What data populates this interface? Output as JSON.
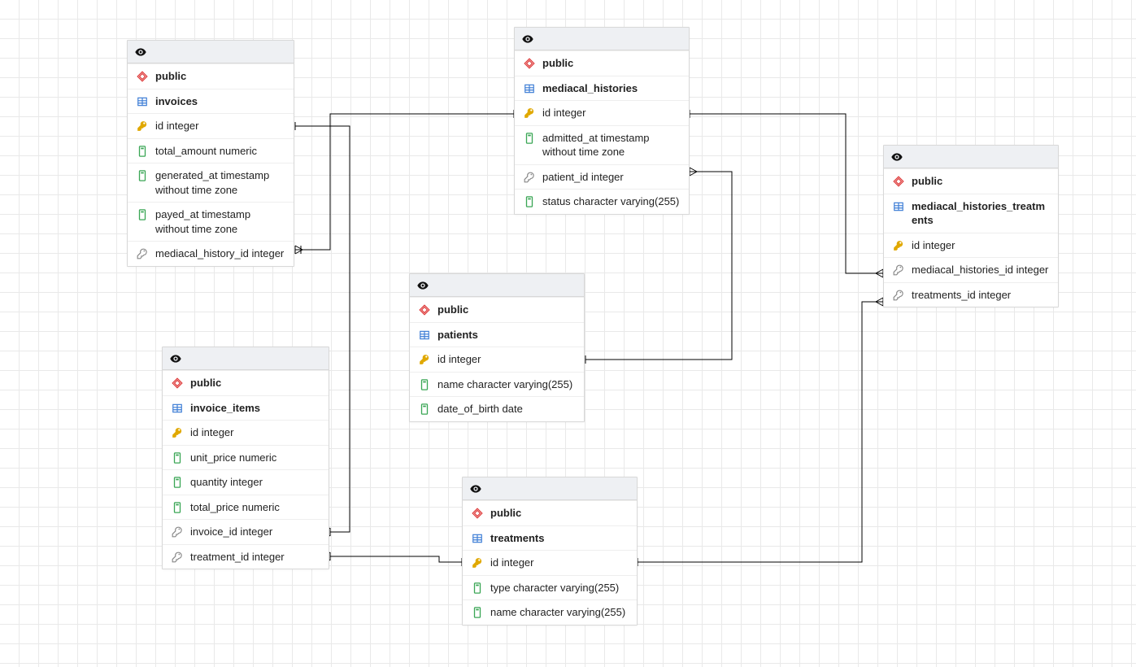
{
  "entities": {
    "invoices": {
      "schema": "public",
      "table": "invoices",
      "columns": [
        {
          "kind": "pk",
          "label": "id integer"
        },
        {
          "kind": "col",
          "label": "total_amount numeric"
        },
        {
          "kind": "col",
          "label": "generated_at timestamp without time zone"
        },
        {
          "kind": "col",
          "label": "payed_at timestamp without time zone"
        },
        {
          "kind": "fk",
          "label": "mediacal_history_id integer"
        }
      ]
    },
    "mediacal_histories": {
      "schema": "public",
      "table": "mediacal_histories",
      "columns": [
        {
          "kind": "pk",
          "label": "id integer"
        },
        {
          "kind": "col",
          "label": "admitted_at timestamp without time zone"
        },
        {
          "kind": "fk",
          "label": "patient_id integer"
        },
        {
          "kind": "col",
          "label": "status character varying(255)"
        }
      ]
    },
    "mediacal_histories_treatments": {
      "schema": "public",
      "table": "mediacal_histories_treatments",
      "columns": [
        {
          "kind": "pk",
          "label": "id integer"
        },
        {
          "kind": "fk",
          "label": "mediacal_histories_id integer"
        },
        {
          "kind": "fk",
          "label": "treatments_id integer"
        }
      ]
    },
    "patients": {
      "schema": "public",
      "table": "patients",
      "columns": [
        {
          "kind": "pk",
          "label": "id integer"
        },
        {
          "kind": "col",
          "label": "name character varying(255)"
        },
        {
          "kind": "col",
          "label": "date_of_birth date"
        }
      ]
    },
    "invoice_items": {
      "schema": "public",
      "table": "invoice_items",
      "columns": [
        {
          "kind": "pk",
          "label": "id integer"
        },
        {
          "kind": "col",
          "label": "unit_price numeric"
        },
        {
          "kind": "col",
          "label": "quantity integer"
        },
        {
          "kind": "col",
          "label": "total_price numeric"
        },
        {
          "kind": "fk",
          "label": "invoice_id integer"
        },
        {
          "kind": "fk",
          "label": "treatment_id integer"
        }
      ]
    },
    "treatments": {
      "schema": "public",
      "table": "treatments",
      "columns": [
        {
          "kind": "pk",
          "label": "id integer"
        },
        {
          "kind": "col",
          "label": "type character varying(255)"
        },
        {
          "kind": "col",
          "label": "name character varying(255)"
        }
      ]
    }
  }
}
